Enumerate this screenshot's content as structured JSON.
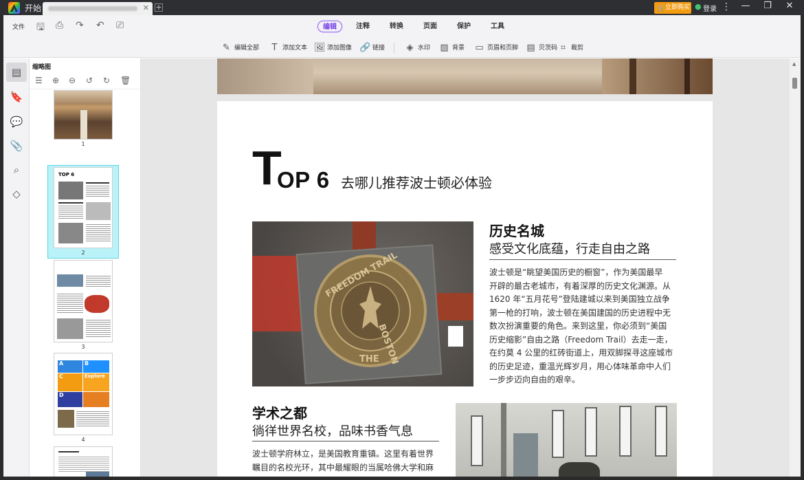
{
  "titlebar": {
    "home_label": "开始",
    "buy_label": "立即购买",
    "login_label": "登录",
    "colors": {
      "bar": "#2d2f33",
      "buy": "#f39c12",
      "user": "#3ec46d"
    }
  },
  "menu": {
    "file_label": "文件",
    "tabs": [
      {
        "label": "编辑",
        "active": true
      },
      {
        "label": "注释",
        "active": false
      },
      {
        "label": "转换",
        "active": false
      },
      {
        "label": "页面",
        "active": false
      },
      {
        "label": "保护",
        "active": false
      },
      {
        "label": "工具",
        "active": false
      }
    ],
    "active_color": "#7a45e6"
  },
  "tools": {
    "edit_all": "编辑全部",
    "add_text": "添加文本",
    "add_image": "添加图像",
    "link": "链接",
    "watermark": "水印",
    "background": "背景",
    "header_footer": "页眉和页脚",
    "bates": "贝茨码",
    "crop": "裁剪"
  },
  "thumbnails": {
    "title": "缩略图",
    "pages": [
      "1",
      "2",
      "3",
      "4"
    ],
    "selected_page": "2",
    "selection_color": "#b9f2f9"
  },
  "document": {
    "title_T": "T",
    "title_rest": "OP 6",
    "title_cn": "去哪儿推荐波士顿必体验",
    "section1": {
      "heading": "历史名城",
      "subheading": "感受文化底蕴，行走自由之路",
      "lines": [
        "波士顿是“眺望美国历史的橱窗”，作为美国最早",
        "开辟的最古老城市，有着深厚的历史文化渊源。从",
        "1620 年“五月花号”登陆建城以来到美国独立战争",
        "第一枪的打响，波士顿在美国建国的历史进程中无",
        "数次扮演重要的角色。来到这里，你必须到“美国",
        "历史缩影”自由之路（Freedom Trail）去走一走，",
        "在约莫 4 公里的红砖街道上，用双脚探寻这座城市",
        "的历史足迹，重温光辉岁月，用心体味革命中人们",
        "一步步迈向自由的艰辛。"
      ]
    },
    "section2": {
      "heading": "学术之都",
      "subheading": "徜徉世界名校，品味书香气息",
      "lines": [
        "波士顿学府林立，是美国教育重镇。这里有着世界",
        "瞩目的名校光环，其中最耀眼的当属哈佛大学和麻"
      ]
    },
    "seal_text": {
      "top": "FREEDOM TRAIL",
      "right": "BOSTON",
      "bottom": "THE"
    },
    "thumbnail_texts": {
      "p2_title": "TOP 6",
      "p4_blocks": [
        "A",
        "B",
        "C",
        "Explore",
        "D"
      ]
    }
  }
}
